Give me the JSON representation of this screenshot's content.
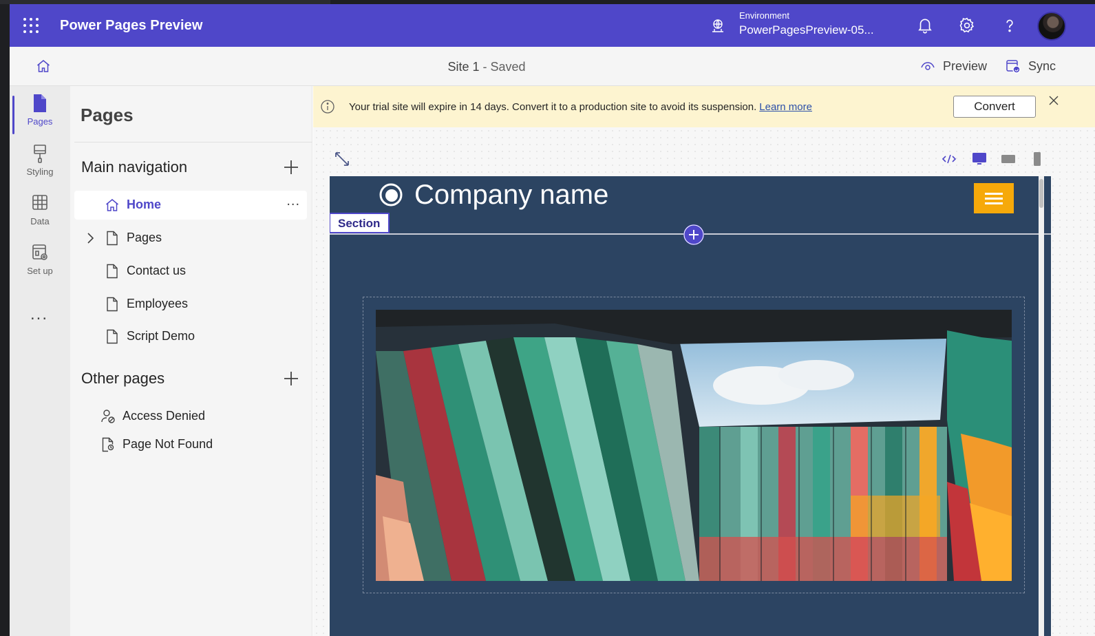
{
  "header": {
    "app_title": "Power Pages Preview",
    "environment_label": "Environment",
    "environment_value": "PowerPagesPreview-05...",
    "accent_color": "#4f47c9"
  },
  "cmdbar": {
    "site_name": "Site 1",
    "site_state": " - Saved",
    "preview_label": "Preview",
    "sync_label": "Sync"
  },
  "rail": {
    "items": [
      {
        "label": "Pages",
        "icon": "page-icon",
        "active": true
      },
      {
        "label": "Styling",
        "icon": "paintbrush-icon"
      },
      {
        "label": "Data",
        "icon": "table-icon"
      },
      {
        "label": "Set up",
        "icon": "setup-icon"
      }
    ],
    "more": "..."
  },
  "panel": {
    "title": "Pages",
    "main_navigation": {
      "title": "Main navigation",
      "items": [
        {
          "label": "Home",
          "icon": "home-icon",
          "selected": true,
          "more": "..."
        },
        {
          "label": "Pages",
          "icon": "page-icon",
          "expandable": true
        },
        {
          "label": "Contact us",
          "icon": "page-icon"
        },
        {
          "label": "Employees",
          "icon": "page-icon"
        },
        {
          "label": "Script Demo",
          "icon": "page-icon"
        }
      ]
    },
    "other_pages": {
      "title": "Other pages",
      "items": [
        {
          "label": "Access Denied",
          "icon": "person-blocked-icon"
        },
        {
          "label": "Page Not Found",
          "icon": "page-search-icon"
        }
      ]
    }
  },
  "banner": {
    "message": "Your trial site will expire in 14 days. Convert it to a production site to avoid its suspension.",
    "link": "Learn more",
    "button": "Convert",
    "background": "#fdf4d0"
  },
  "canvas": {
    "company_name": "Company name",
    "section_label": "Section",
    "background": "#2c4462",
    "menu_color": "#f6a90a"
  }
}
